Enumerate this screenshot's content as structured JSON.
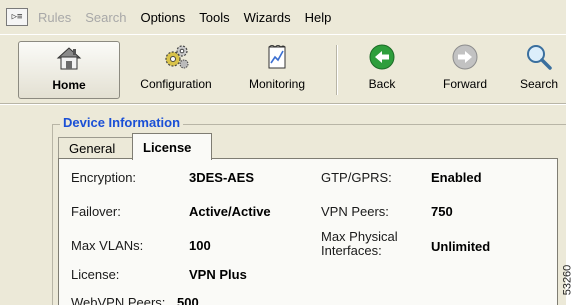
{
  "menubar": {
    "items": [
      {
        "label": "Rules",
        "disabled": true
      },
      {
        "label": "Search",
        "disabled": true
      },
      {
        "label": "Options",
        "disabled": false
      },
      {
        "label": "Tools",
        "disabled": false
      },
      {
        "label": "Wizards",
        "disabled": false
      },
      {
        "label": "Help",
        "disabled": false
      }
    ]
  },
  "toolbar": {
    "buttons": [
      {
        "label": "Home",
        "icon": "home-icon",
        "active": true
      },
      {
        "label": "Configuration",
        "icon": "gears-icon",
        "active": false
      },
      {
        "label": "Monitoring",
        "icon": "monitor-chart-icon",
        "active": false
      },
      {
        "label": "Back",
        "icon": "back-arrow-icon",
        "active": false
      },
      {
        "label": "Forward",
        "icon": "forward-arrow-icon",
        "active": false
      },
      {
        "label": "Search",
        "icon": "magnifier-icon",
        "active": false
      }
    ]
  },
  "device_info": {
    "title": "Device Information",
    "tabs": [
      {
        "label": "General",
        "selected": false
      },
      {
        "label": "License",
        "selected": true
      }
    ],
    "fields": {
      "encryption_label": "Encryption:",
      "encryption_value": "3DES-AES",
      "failover_label": "Failover:",
      "failover_value": "Active/Active",
      "max_vlans_label": "Max VLANs:",
      "max_vlans_value": "100",
      "license_label": "License:",
      "license_value": "VPN Plus",
      "webvpn_label": "WebVPN Peers:",
      "webvpn_value": "500",
      "gtp_label": "GTP/GPRS:",
      "gtp_value": "Enabled",
      "vpn_peers_label": "VPN Peers:",
      "vpn_peers_value": "750",
      "max_phys_label_1": "Max Physical",
      "max_phys_label_2": "Interfaces:",
      "max_phys_value": "Unlimited"
    }
  },
  "figure_code": "53260",
  "colors": {
    "chrome": "#ece9d8",
    "panel": "#fafaf7",
    "title_blue": "#1a4fd6",
    "back_green": "#2e9e3c"
  }
}
